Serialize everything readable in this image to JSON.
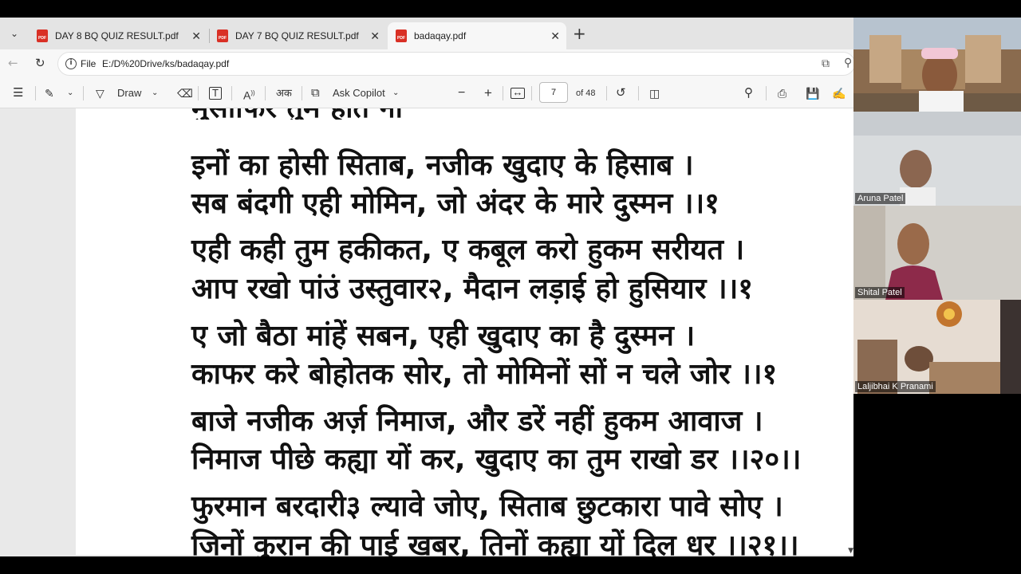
{
  "tabs": [
    {
      "title": "DAY 8 BQ QUIZ RESULT.pdf"
    },
    {
      "title": "DAY 7 BQ QUIZ RESULT.pdf"
    },
    {
      "title": "badaqay.pdf"
    }
  ],
  "address": {
    "scheme_label": "File",
    "url": "E:/D%20Drive/ks/badaqay.pdf"
  },
  "toolbar": {
    "draw_label": "Draw",
    "copilot_label": "Ask Copilot",
    "page_number": "7",
    "page_total": "of 48",
    "aa_label": "A",
    "ak_label": "अक"
  },
  "document": {
    "lines": [
      "इनों का होसी सिताब, नजीक खुदाए के हिसाब ।",
      "सब बंदगी एही मोमिन, जो अंदर के मारे दुस्मन ।।१",
      "एही कही तुम हकीकत, ए कबूल करो हुकम सरीयत ।",
      "आप रखो पांउं उस्तुवार२, मैदान लड़ाई हो हुसियार ।।१",
      "ए जो बैठा मांहें सबन, एही खुदाए का है दुस्मन ।",
      "काफर करे बोहोतक सोर, तो मोमिनों सों न चले जोर ।।१",
      "बाजे नजीक अर्ज़ निमाज, और डरें नहीं हुकम आवाज ।",
      "निमाज पीछे कह्या यों कर, खुदाए का तुम राखो डर ।।२०।।",
      "फुरमान बरदारी३ ल्यावे जोए, सिताब छुटकारा पावे सोए ।",
      "जिनों कुरान की पाई खबर, तिनों कह्या यों दिल धर ।।२१।।"
    ]
  },
  "participants": [
    {
      "name": ""
    },
    {
      "name": "Aruna Patel"
    },
    {
      "name": "Shital Patel"
    },
    {
      "name": "Laljibhai K Pranami"
    }
  ]
}
